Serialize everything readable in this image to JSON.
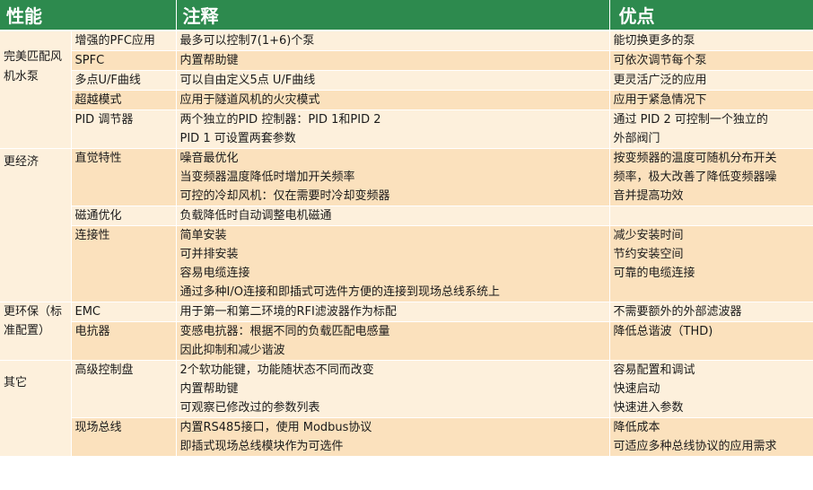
{
  "header": {
    "col1": "性能",
    "col2": "注释",
    "col3": "优点"
  },
  "rows": [
    {
      "category": "完美匹配风机水泵",
      "feature": "增强的PFC应用",
      "notes": [
        "最多可以控制7(1+6)个泵"
      ],
      "benefits": [
        "能切换更多的泵"
      ]
    },
    {
      "feature": "SPFC",
      "notes": [
        "内置帮助键"
      ],
      "benefits": [
        "可依次调节每个泵"
      ]
    },
    {
      "feature": "多点U/F曲线",
      "notes": [
        "可以自由定义5点  U/F曲线"
      ],
      "benefits": [
        "更灵活广泛的应用"
      ]
    },
    {
      "feature": "超越模式",
      "notes": [
        "应用于隧道风机的火灾模式"
      ],
      "benefits": [
        "应用于紧急情况下"
      ]
    },
    {
      "feature": "PID 调节器",
      "notes": [
        "两个独立的PID 控制器：PID 1和PID 2",
        "PID 1 可设置两套参数"
      ],
      "benefits": [
        "通过  PID 2 可控制一个独立的",
        "外部阀门"
      ]
    },
    {
      "category": "更经济",
      "feature": "直觉特性",
      "notes": [
        "噪音最优化",
        "当变频器温度降低时增加开关频率",
        "可控的冷却风机：仅在需要时冷却变频器"
      ],
      "benefits": [
        "按变频器的温度可随机分布开关",
        "频率，极大改善了降低变频器噪",
        "音并提高功效"
      ]
    },
    {
      "feature": "磁通优化",
      "notes": [
        "负载降低时自动调整电机磁通"
      ],
      "benefits": [
        ""
      ]
    },
    {
      "feature": "连接性",
      "notes": [
        "简单安装",
        "可并排安装",
        "容易电缆连接",
        "通过多种I/O连接和即插式可选件方便的连接到现场总线系统上"
      ],
      "benefits": [
        "减少安装时间",
        "节约安装空间",
        "可靠的电缆连接"
      ]
    },
    {
      "category": "更环保（标准配置）",
      "feature": "EMC",
      "notes": [
        "用于第一和第二环境的RFI滤波器作为标配"
      ],
      "benefits": [
        "不需要额外的外部滤波器"
      ]
    },
    {
      "feature": "电抗器",
      "notes": [
        "变感电抗器：根据不同的负载匹配电感量",
        "因此抑制和减少谐波"
      ],
      "benefits": [
        "降低总谐波（THD)"
      ]
    },
    {
      "category": "其它",
      "feature": "高级控制盘",
      "notes": [
        "2个软功能键，功能随状态不同而改变",
        "内置帮助键",
        "可观察已修改过的参数列表"
      ],
      "benefits": [
        "容易配置和调试",
        "快速启动",
        "快速进入参数"
      ]
    },
    {
      "feature": "现场总线",
      "notes": [
        "内置RS485接口，使用  Modbus协议",
        "即插式现场总线模块作为可选件"
      ],
      "benefits": [
        "降低成本",
        "可适应多种总线协议的应用需求"
      ]
    }
  ],
  "colors": {
    "header": "#2d8a4e",
    "row_light": "#fdf0dc",
    "row_dark": "#fbe1bd"
  }
}
